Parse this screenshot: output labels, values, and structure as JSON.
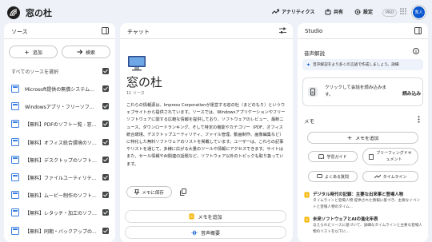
{
  "header": {
    "title": "窓の杜",
    "analytics": "アナリティクス",
    "share": "共有",
    "settings": "設定",
    "pro": "PRO",
    "avatar_text": "秀人"
  },
  "sources": {
    "title": "ソース",
    "add": "追加",
    "search": "検索",
    "select_all": "すべてのソースを選択",
    "items": [
      "Microsoft提供の無償システム...",
      "Windowsアプリ・フリーソフト...",
      "【無料】PDFのソフト一覧 - 窓...",
      "【無料】オフィス統合環境のソフ...",
      "【無料】デスクトップのソフト一覧...",
      "【無料】ファイルユーティリティ...",
      "【無料】ムービー制作のソフト...",
      "【無料】レタッチ・加工のソフト...",
      "【無料】同期・バックアップの..."
    ]
  },
  "chat": {
    "title": "チャット",
    "notebook_title": "窓の杜",
    "source_count": "11 ソース",
    "summary": "これらの情報源は、Impress Corporationが運営する窓の杜（まどのもり）というウェブサイトから提供されています。ソースでは、Windowsアプリケーションやフリーソフトウェアに関する広範な情報を提供しており、ソフトウェアのレビュー、最新ニュース、ダウンロードランキング、そして特定の機能やカテゴリー（PDF、オフィス統合環境、デスクトップユーティリティ、ファイル管理、動画制作、画像編集など）に特化した無料ソフトウェアのリストを掲載しています。ユーザーは、これらの記事やリストを通じて、多様に広がる大量のツールや情報にアクセスできます。サイトはまた、セール情報やAI関連の話題など、ソフトウェア以外のトピックも取り扱っています。",
    "save_note": "メモに保存",
    "add_note": "メモを追加",
    "audio_overview": "音声概要"
  },
  "studio": {
    "title": "Studio",
    "audio_section": "音声解説",
    "lang_note": "音声解説をより多くの言語で作成しましょう。詳細",
    "audio_prompt": "クリックして会話を読み込みます。",
    "load": "読み込み",
    "notes_section": "メモ",
    "add_note": "メモを追加",
    "chips": [
      "学習ガイド",
      "ブリーフィングドキュメント",
      "よくある質問",
      "タイムライン"
    ],
    "notes": [
      {
        "title": "デジタル時代の記録：主要な出来事と登場人物",
        "body": "タイムラインと登場人物 提供された情報に基づき、主要なイベントと登場人物のタイム..."
      },
      {
        "title": "未来ソフトウェアとAIの進化年表",
        "body": "与えられたソースに基づいて、詳細なタイムラインと主要な登場人物のリストを以下に..."
      }
    ]
  },
  "colors": {
    "background": "#eef1f8",
    "accent": "#0b57d0",
    "checkbox": "#444746",
    "note_icon": "#f5b400"
  }
}
